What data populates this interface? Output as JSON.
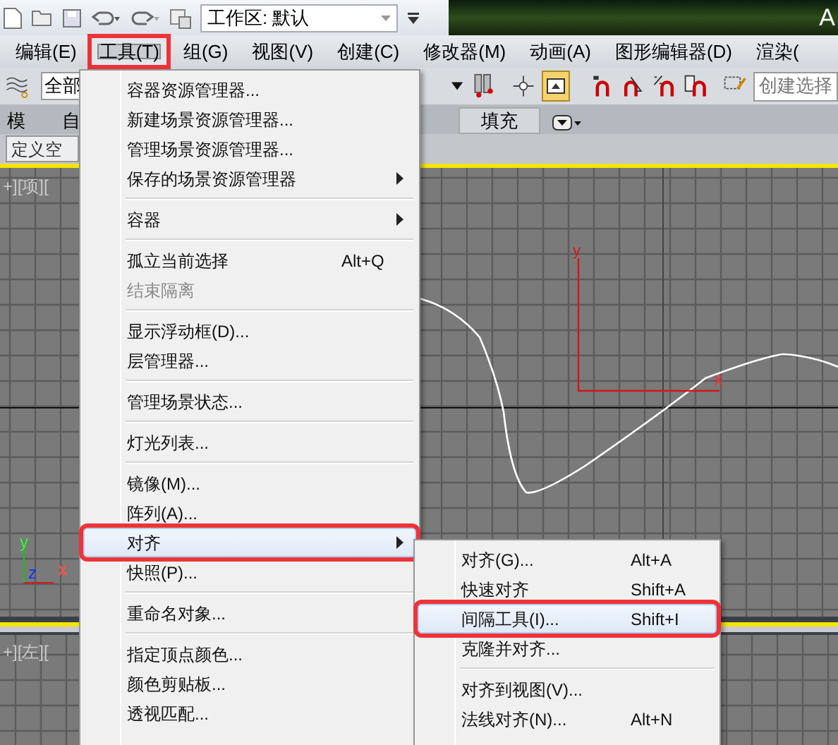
{
  "quick_access": {
    "workspace": "工作区: 默认"
  },
  "title_bar": {
    "title": "A"
  },
  "menu_bar": [
    {
      "label": "编辑(E)",
      "selected": false,
      "marked": false
    },
    {
      "label": "工具(T)",
      "selected": true,
      "marked": true
    },
    {
      "label": "组(G)",
      "selected": false,
      "marked": false
    },
    {
      "label": "视图(V)",
      "selected": false,
      "marked": false
    },
    {
      "label": "创建(C)",
      "selected": false,
      "marked": false
    },
    {
      "label": "修改器(M)",
      "selected": false,
      "marked": false
    },
    {
      "label": "动画(A)",
      "selected": false,
      "marked": false
    },
    {
      "label": "图形编辑器(D)",
      "selected": false,
      "marked": false
    },
    {
      "label": "渲染(",
      "selected": false,
      "marked": false
    }
  ],
  "toolbar": {
    "selection_filter": "全部",
    "named_selection": "创建选择"
  },
  "ribbon": {
    "tabs": [
      {
        "label": "模",
        "selected": false
      },
      {
        "label": "自",
        "selected": false
      },
      {
        "label": "填充",
        "selected": true
      }
    ]
  },
  "scene_tab": "定义空",
  "viewports": [
    {
      "label": "+][项][",
      "gizmo": [
        "y",
        "x"
      ],
      "corner_axes": [
        "y",
        "z",
        "x"
      ]
    },
    {
      "label": "+][左]["
    }
  ],
  "tools_menu": [
    {
      "kind": "item",
      "label": "容器资源管理器...",
      "has_submenu": false,
      "disabled": false,
      "selected": false,
      "marked": false
    },
    {
      "kind": "item",
      "label": "新建场景资源管理器...",
      "has_submenu": false,
      "disabled": false,
      "selected": false,
      "marked": false
    },
    {
      "kind": "item",
      "label": "管理场景资源管理器...",
      "has_submenu": false,
      "disabled": false,
      "selected": false,
      "marked": false
    },
    {
      "kind": "item",
      "label": "保存的场景资源管理器",
      "has_submenu": true,
      "disabled": false,
      "selected": false,
      "marked": false
    },
    {
      "kind": "separator"
    },
    {
      "kind": "item",
      "label": "容器",
      "has_submenu": true,
      "disabled": false,
      "selected": false,
      "marked": false
    },
    {
      "kind": "separator"
    },
    {
      "kind": "item",
      "label": "孤立当前选择",
      "shortcut": "Alt+Q",
      "has_submenu": false,
      "disabled": false,
      "selected": false,
      "marked": false
    },
    {
      "kind": "item",
      "label": "结束隔离",
      "has_submenu": false,
      "disabled": true,
      "selected": false,
      "marked": false
    },
    {
      "kind": "separator"
    },
    {
      "kind": "item",
      "label": "显示浮动框(D)...",
      "has_submenu": false,
      "disabled": false,
      "selected": false,
      "marked": false
    },
    {
      "kind": "item",
      "label": "层管理器...",
      "has_submenu": false,
      "disabled": false,
      "selected": false,
      "marked": false
    },
    {
      "kind": "separator"
    },
    {
      "kind": "item",
      "label": "管理场景状态...",
      "has_submenu": false,
      "disabled": false,
      "selected": false,
      "marked": false
    },
    {
      "kind": "separator"
    },
    {
      "kind": "item",
      "label": "灯光列表...",
      "has_submenu": false,
      "disabled": false,
      "selected": false,
      "marked": false
    },
    {
      "kind": "separator"
    },
    {
      "kind": "item",
      "label": "镜像(M)...",
      "has_submenu": false,
      "disabled": false,
      "selected": false,
      "marked": false
    },
    {
      "kind": "item",
      "label": "阵列(A)...",
      "has_submenu": false,
      "disabled": false,
      "selected": false,
      "marked": false
    },
    {
      "kind": "item",
      "label": "对齐",
      "has_submenu": true,
      "disabled": false,
      "selected": true,
      "marked": true
    },
    {
      "kind": "item",
      "label": "快照(P)...",
      "has_submenu": false,
      "disabled": false,
      "selected": false,
      "marked": false
    },
    {
      "kind": "separator"
    },
    {
      "kind": "item",
      "label": "重命名对象...",
      "has_submenu": false,
      "disabled": false,
      "selected": false,
      "marked": false
    },
    {
      "kind": "separator"
    },
    {
      "kind": "item",
      "label": "指定顶点颜色...",
      "has_submenu": false,
      "disabled": false,
      "selected": false,
      "marked": false
    },
    {
      "kind": "item",
      "label": "颜色剪贴板...",
      "has_submenu": false,
      "disabled": false,
      "selected": false,
      "marked": false
    },
    {
      "kind": "item",
      "label": "透视匹配...",
      "has_submenu": false,
      "disabled": false,
      "selected": false,
      "marked": false
    }
  ],
  "align_submenu": [
    {
      "kind": "item",
      "label": "对齐(G)...",
      "shortcut": "Alt+A",
      "has_submenu": false,
      "disabled": false,
      "selected": false,
      "marked": false
    },
    {
      "kind": "item",
      "label": "快速对齐",
      "shortcut": "Shift+A",
      "has_submenu": false,
      "disabled": false,
      "selected": false,
      "marked": false
    },
    {
      "kind": "item",
      "label": "间隔工具(I)...",
      "shortcut": "Shift+I",
      "has_submenu": false,
      "disabled": false,
      "selected": true,
      "marked": true
    },
    {
      "kind": "item",
      "label": "克隆并对齐...",
      "has_submenu": false,
      "disabled": false,
      "selected": false,
      "marked": false
    },
    {
      "kind": "separator"
    },
    {
      "kind": "item",
      "label": "对齐到视图(V)...",
      "has_submenu": false,
      "disabled": false,
      "selected": false,
      "marked": false
    },
    {
      "kind": "item",
      "label": "法线对齐(N)...",
      "shortcut": "Alt+N",
      "has_submenu": false,
      "disabled": false,
      "selected": false,
      "marked": false
    }
  ]
}
